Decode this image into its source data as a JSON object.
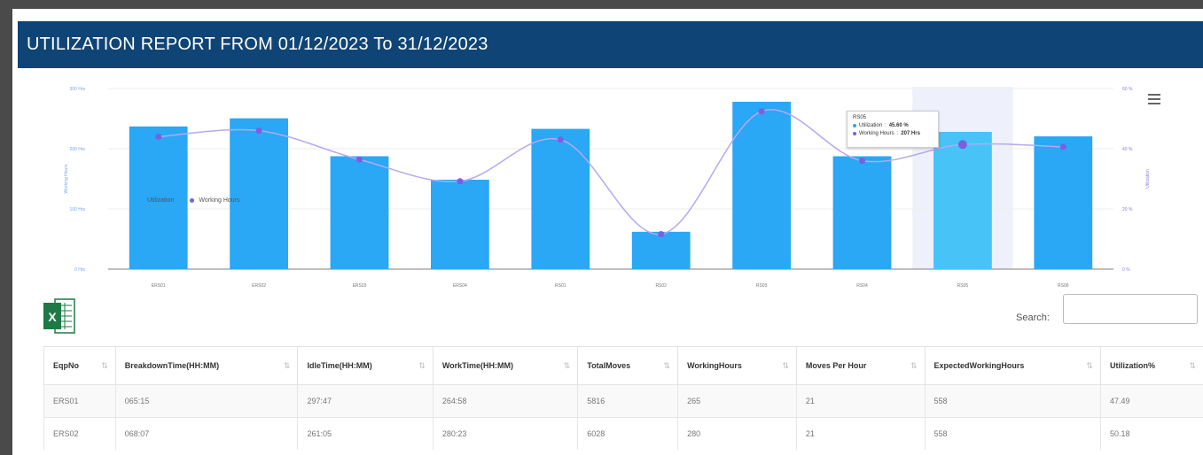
{
  "header": {
    "title": "UTILIZATION REPORT FROM 01/12/2023 To 31/12/2023"
  },
  "chart_data": {
    "type": "bar",
    "categories": [
      "ERS01",
      "ERS02",
      "ERS03",
      "ERS04",
      "RS01",
      "RS02",
      "RS03",
      "RS04",
      "RS05",
      "RS06"
    ],
    "series": [
      {
        "name": "Utilization",
        "kind": "bar",
        "axis": "right",
        "color": "#2aa7f5",
        "values": [
          47.4,
          50.1,
          37.5,
          29.7,
          46.6,
          12.4,
          55.6,
          37.5,
          45.6,
          44.1
        ]
      },
      {
        "name": "Working Hours",
        "kind": "spline",
        "axis": "left",
        "color": "#7b5fe0",
        "values": [
          220,
          230,
          182,
          146,
          215,
          58,
          262,
          180,
          207,
          203
        ]
      }
    ],
    "left_ylim": [
      0,
      300
    ],
    "right_ylim": [
      0,
      60
    ],
    "left_ticks": [
      "0 Hrs",
      "100 Hrs",
      "200 Hrs",
      "300 Hrs"
    ],
    "right_ticks": [
      "0 %",
      "20 %",
      "40 %",
      "60 %"
    ],
    "ylabel_left": "Working Hours",
    "ylabel_right": "Utilization",
    "highlight_category": "RS05",
    "legend_placement": "inside-left",
    "tooltip": {
      "category": "RS05",
      "utilization_label": "Utilization",
      "utilization_value": "45.60 %",
      "hours_label": "Working Hours",
      "hours_value": "207 Hrs"
    }
  },
  "toolbar": {
    "excel_label": "X",
    "search_label": "Search:",
    "search_value": ""
  },
  "table": {
    "columns": [
      "EqpNo",
      "BreakdownTime(HH:MM)",
      "IdleTime(HH:MM)",
      "WorkTime(HH:MM)",
      "TotalMoves",
      "WorkingHours",
      "Moves Per Hour",
      "ExpectedWorkingHours",
      "Utilization%"
    ],
    "rows": [
      [
        "ERS01",
        "065:15",
        "297:47",
        "264:58",
        "5816",
        "265",
        "21",
        "558",
        "47.49"
      ],
      [
        "ERS02",
        "068:07",
        "261:05",
        "280:23",
        "6028",
        "280",
        "21",
        "558",
        "50.18"
      ]
    ]
  }
}
